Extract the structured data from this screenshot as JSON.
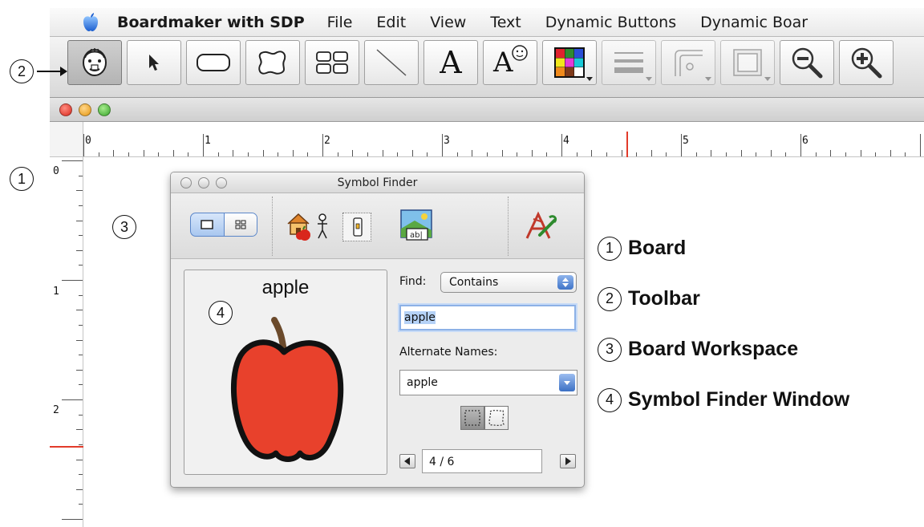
{
  "menubar": {
    "app_name": "Boardmaker with SDP",
    "items": [
      "File",
      "Edit",
      "View",
      "Text",
      "Dynamic Buttons",
      "Dynamic Boar"
    ]
  },
  "toolbar": {
    "tools": [
      {
        "name": "symbol-finder-tool-icon",
        "active": true
      },
      {
        "name": "pointer-tool-icon"
      },
      {
        "name": "button-tool-icon"
      },
      {
        "name": "freeform-button-tool-icon"
      },
      {
        "name": "button-sequencer-tool-icon"
      },
      {
        "name": "line-tool-icon"
      },
      {
        "name": "text-tool-icon",
        "label": "A"
      },
      {
        "name": "symbolate-text-tool-icon",
        "label": "A"
      },
      {
        "name": "color-palette-icon"
      },
      {
        "name": "line-thickness-icon"
      },
      {
        "name": "corner-style-icon"
      },
      {
        "name": "border-style-icon"
      },
      {
        "name": "zoom-out-icon"
      },
      {
        "name": "zoom-in-icon"
      }
    ]
  },
  "ruler": {
    "h_numbers": [
      "0",
      "1",
      "2",
      "3",
      "4",
      "5",
      "6"
    ],
    "v_numbers": [
      "0",
      "1",
      "2"
    ]
  },
  "callouts": {
    "toolbar_marker": "2",
    "board_marker": "1",
    "workspace_marker": "3",
    "finder_marker": "4"
  },
  "legend": [
    {
      "num": "1",
      "label": "Board"
    },
    {
      "num": "2",
      "label": "Toolbar"
    },
    {
      "num": "3",
      "label": "Board Workspace"
    },
    {
      "num": "4",
      "label": "Symbol Finder Window"
    }
  ],
  "symbol_finder": {
    "title": "Symbol Finder",
    "symbol_name": "apple",
    "find_label": "Find:",
    "find_mode": "Contains",
    "search_value": "apple",
    "alternate_label": "Alternate Names:",
    "alternate_value": "apple",
    "page": "4 / 6"
  },
  "colors": {
    "apple_red": "#e8412c",
    "stem_brown": "#6b4a2b",
    "accent_blue": "#3f74c8",
    "ruler_marker": "#e23b2a"
  }
}
